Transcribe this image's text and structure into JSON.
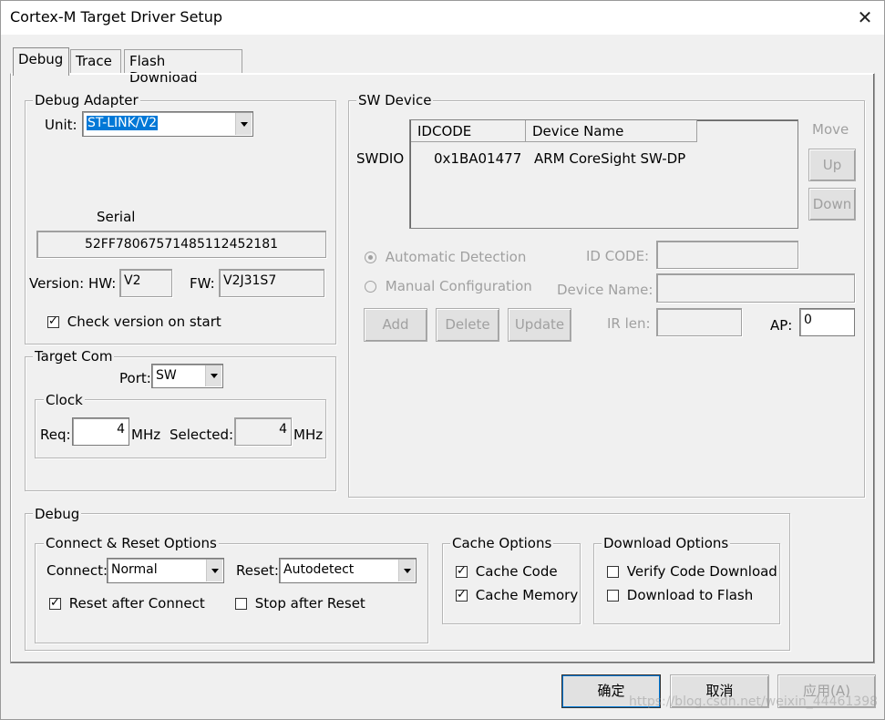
{
  "window": {
    "title": "Cortex-M Target Driver Setup",
    "close_glyph": "✕"
  },
  "tabs": [
    {
      "label": "Debug",
      "active": true
    },
    {
      "label": "Trace",
      "active": false
    },
    {
      "label": "Flash Download",
      "active": false
    }
  ],
  "debug_adapter": {
    "title": "Debug Adapter",
    "unit_label": "Unit:",
    "unit_value": "ST-LINK/V2",
    "serial_label": "Serial",
    "serial_value": "52FF7806757148511245218‌1",
    "version_label": "Version: HW:",
    "hw_value": "V2",
    "fw_label": "FW:",
    "fw_value": "V2J31S7",
    "check_version_label": "Check version on start",
    "check_version_checked": true
  },
  "target_com": {
    "title": "Target Com",
    "port_label": "Port:",
    "port_value": "SW",
    "clock_title": "Clock",
    "req_label": "Req:",
    "req_value": "4",
    "req_unit": "MHz",
    "selected_label": "Selected:",
    "selected_value": "4",
    "selected_unit": "MHz"
  },
  "sw_device": {
    "title": "SW Device",
    "swdio_label": "SWDIO",
    "columns": [
      "IDCODE",
      "Device Name"
    ],
    "rows": [
      {
        "idcode": "0x1BA01477",
        "device_name": "ARM CoreSight SW-DP"
      }
    ],
    "move_label": "Move",
    "up_label": "Up",
    "down_label": "Down",
    "auto_detect_label": "Automatic Detection",
    "manual_config_label": "Manual Configuration",
    "id_code_label": "ID CODE:",
    "device_name_label": "Device Name:",
    "add_label": "Add",
    "delete_label": "Delete",
    "update_label": "Update",
    "ir_len_label": "IR len:",
    "ap_label": "AP:",
    "ap_value": "0"
  },
  "debug_section": {
    "title": "Debug",
    "connect_reset": {
      "title": "Connect & Reset Options",
      "connect_label": "Connect:",
      "connect_value": "Normal",
      "reset_label": "Reset:",
      "reset_value": "Autodetect",
      "reset_after_connect_label": "Reset after Connect",
      "reset_after_connect_checked": true,
      "stop_after_reset_label": "Stop after Reset",
      "stop_after_reset_checked": false
    },
    "cache": {
      "title": "Cache Options",
      "cache_code_label": "Cache Code",
      "cache_code_checked": true,
      "cache_memory_label": "Cache Memory",
      "cache_memory_checked": true
    },
    "download": {
      "title": "Download Options",
      "verify_label": "Verify Code Download",
      "verify_checked": false,
      "flash_label": "Download to Flash",
      "flash_checked": false
    }
  },
  "footer": {
    "ok_label": "确定",
    "cancel_label": "取消",
    "apply_label": "应用(A)",
    "watermark": "https://blog.csdn.net/weixin_44461398"
  }
}
